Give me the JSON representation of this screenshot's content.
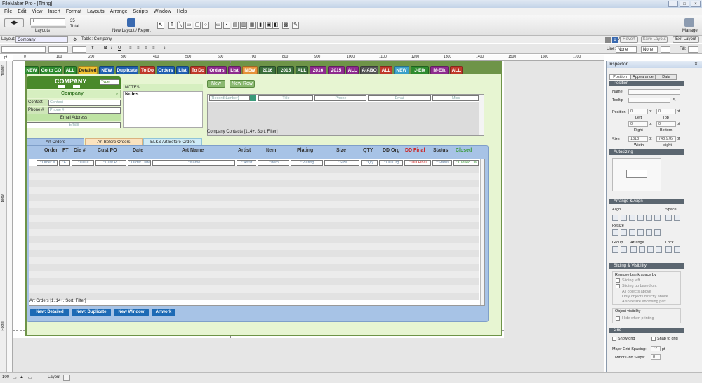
{
  "window": {
    "title": "FileMaker Pro - [Thing]",
    "controls": [
      "_",
      "□",
      "×"
    ]
  },
  "menu": [
    "File",
    "Edit",
    "View",
    "Insert",
    "Format",
    "Layouts",
    "Arrange",
    "Scripts",
    "Window",
    "Help"
  ],
  "status_toolbar": {
    "layout_number": "1",
    "layouts_label": "Layouts",
    "count": "35",
    "total_label": "Total",
    "new_layout_label": "New Layout / Report",
    "manage_label": "Manage"
  },
  "layout_bar": {
    "layout_label": "Layout:",
    "layout_value": "Company",
    "table_label": "Table: Company",
    "aa_label": "Aa",
    "revert_label": "Revert",
    "save_label": "Save Layout",
    "exit_label": "Exit Layout"
  },
  "format_bar": {
    "line_label": "Line:",
    "line_value": "None",
    "fill_label": "Fill:",
    "none_label": "None",
    "bold": "B",
    "italic": "I",
    "underline": "U",
    "text_tool": "T"
  },
  "ruler": {
    "marks": [
      "0",
      "100",
      "200",
      "300",
      "400",
      "500",
      "600",
      "700",
      "800",
      "900",
      "1000",
      "1100",
      "1200",
      "1300",
      "1400",
      "1500",
      "1600",
      "1700",
      "1800"
    ],
    "units": "pt"
  },
  "parts": {
    "header": "Header",
    "body": "Body",
    "footer": "Footer"
  },
  "nav_buttons": [
    {
      "label": "NEW",
      "color": "#2e8b2e"
    },
    {
      "label": "Go to CO",
      "color": "#2e8b2e"
    },
    {
      "label": "ALL",
      "color": "#2e8b2e"
    },
    {
      "label": "Detailed",
      "color": "#f1c232",
      "text": "#222"
    },
    {
      "label": "NEW",
      "color": "#1f5fb0"
    },
    {
      "label": "Duplicate",
      "color": "#1f5fb0"
    },
    {
      "label": "To Do",
      "color": "#c0392b"
    },
    {
      "label": "Orders",
      "color": "#1f5fb0"
    },
    {
      "label": "List",
      "color": "#1f5fb0"
    },
    {
      "label": "To Do",
      "color": "#c0392b"
    },
    {
      "label": "Orders",
      "color": "#8e2a8e"
    },
    {
      "label": "List",
      "color": "#8e2a8e"
    },
    {
      "label": "NEW",
      "color": "#e69138"
    },
    {
      "label": "2016",
      "color": "#3b6e3b"
    },
    {
      "label": "2015",
      "color": "#3b6e3b"
    },
    {
      "label": "ALL",
      "color": "#3b6e3b"
    },
    {
      "label": "2016",
      "color": "#8e2a8e"
    },
    {
      "label": "2015",
      "color": "#8e2a8e"
    },
    {
      "label": "ALL",
      "color": "#8e2a8e"
    },
    {
      "label": "A-ABO",
      "color": "#555555"
    },
    {
      "label": "ALL",
      "color": "#c0392b"
    },
    {
      "label": "NEW",
      "color": "#3aa0c8"
    },
    {
      "label": "J-Elk",
      "color": "#2e8b2e"
    },
    {
      "label": "M-Elk",
      "color": "#8e2a8e"
    },
    {
      "label": "ALL",
      "color": "#c0392b"
    }
  ],
  "company_panel": {
    "title": "COMPANY",
    "type_label": "Type",
    "company_field": "Company",
    "contact_label": "Contact",
    "contact_field": "Contact",
    "phone_label": "Phone #",
    "phone_field": "Phone #",
    "email_header": "Email Address",
    "email_field": "Email",
    "notes_header": "NOTES:",
    "notes_field": "Notes"
  },
  "contacts": {
    "new_button": "New",
    "new_row_button": "New Row",
    "fields": [
      "[RecordNumber]",
      "Title",
      "Phone",
      "Email",
      "Misc"
    ],
    "caption": "Company Contacts [1..4+, Sort, Filter]"
  },
  "tabs": [
    "Art Orders",
    "Art Before Orders",
    "ELKS Art Before Orders"
  ],
  "orders": {
    "columns": [
      "Order",
      "FT",
      "Die #",
      "Cust PO",
      "Date",
      "Art Name",
      "Artist",
      "Item",
      "Plating",
      "Size",
      "QTY",
      "DD Org",
      "DD Final",
      "Status",
      "Closed"
    ],
    "fields": [
      "::Order #",
      "::FT",
      "::Die #",
      "::Cust PO",
      "::Order Date",
      "::Name",
      "::Artist",
      "::Item",
      "::Plating",
      "::Size",
      "::Qty",
      "::DD Org",
      "::DD Final",
      "::Status",
      "::Closed Da"
    ],
    "caption": "Art Orders [1..14+, Sort, Filter]",
    "buttons": [
      "New: Detailed",
      "New: Duplicate",
      "New Window",
      "Artwork"
    ]
  },
  "inspector": {
    "title": "Inspector",
    "tabs": [
      "Position",
      "Appearance",
      "Data"
    ],
    "position_header": "Position",
    "name_label": "Name",
    "tooltip_label": "Tooltip",
    "position_label": "Position",
    "left_label": "Left",
    "top_label": "Top",
    "right_label": "Right",
    "bottom_label": "Bottom",
    "size_label": "Size",
    "width_label": "Width",
    "height_label": "Height",
    "pos_vals": [
      "0",
      "0",
      "0",
      "0"
    ],
    "width_val": "1318",
    "height_val": "748.976",
    "unit": "pt",
    "autosizing_header": "Autosizing",
    "arrange_header": "Arrange & Align",
    "align_label": "Align",
    "space_label": "Space",
    "resize_label": "Resize",
    "group_label": "Group",
    "arrange_label": "Arrange",
    "lock_label": "Lock",
    "sliding_header": "Sliding & Visibility",
    "remove_blank": "Remove blank space by",
    "sliding_left": "Sliding left",
    "sliding_up": "Sliding up based on:",
    "all_above": "All objects above",
    "only_above": "Only objects directly above",
    "also_resize": "Also resize enclosing part",
    "object_visibility": "Object visibility",
    "hide_printing": "Hide when printing",
    "grid_header": "Grid",
    "show_grid": "Show grid",
    "snap_grid": "Snap to grid",
    "major_spacing": "Major Grid Spacing:",
    "major_val": "72",
    "minor_steps": "Minor Grid Steps:",
    "minor_val": "8"
  },
  "bottom": {
    "zoom": "100",
    "mode": "Layout"
  },
  "colors": {
    "accent": "#6e9448",
    "panel_blue": "#a7c3e6",
    "dd_final": "#cc2222",
    "closed": "#3a9a3a"
  }
}
